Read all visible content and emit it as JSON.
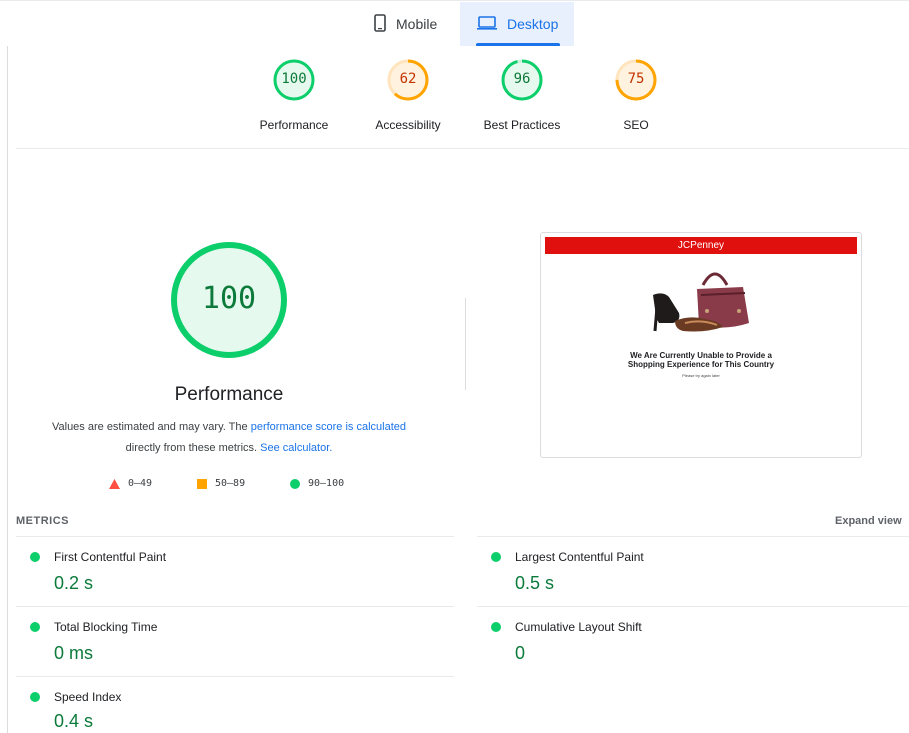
{
  "tabs": [
    {
      "label": "Mobile",
      "icon": "phone-icon"
    },
    {
      "label": "Desktop",
      "icon": "laptop-icon",
      "selected": true
    }
  ],
  "summary": [
    {
      "score": "100",
      "label": "Performance",
      "score_value": 100,
      "color": "#0cce6b",
      "text_color": "#0c7a3a"
    },
    {
      "score": "62",
      "label": "Accessibility",
      "score_value": 62,
      "color": "#ffa400",
      "text_color": "#c33300"
    },
    {
      "score": "96",
      "label": "Best Practices",
      "score_value": 96,
      "color": "#0cce6b",
      "text_color": "#0c7a3a"
    },
    {
      "score": "75",
      "label": "SEO",
      "score_value": 75,
      "color": "#ffa400",
      "text_color": "#c33300"
    }
  ],
  "performance": {
    "score": "100",
    "title": "Performance",
    "description_prefix": "Values are estimated and may vary. The ",
    "link1": "performance score is calculated",
    "description_mid": "directly from these metrics. ",
    "link2": "See calculator.",
    "legend": {
      "fail": "0–49",
      "average": "50–89",
      "pass": "90–100"
    }
  },
  "screenshot": {
    "brand": "JCPenney",
    "heading1": "We Are Currently Unable to Provide a",
    "heading2": "Shopping Experience for This Country",
    "subtext": "Please try again later"
  },
  "metrics": {
    "header": "METRICS",
    "expand": "Expand view",
    "items": [
      {
        "name": "First Contentful Paint",
        "value": "0.2 s"
      },
      {
        "name": "Largest Contentful Paint",
        "value": "0.5 s"
      },
      {
        "name": "Total Blocking Time",
        "value": "0 ms"
      },
      {
        "name": "Cumulative Layout Shift",
        "value": "0"
      },
      {
        "name": "Speed Index",
        "value": "0.4 s"
      }
    ]
  },
  "colors": {
    "pass": "#0cce6b",
    "average": "#ffa400",
    "fail": "#ff4e42",
    "link": "#1a73e8"
  }
}
